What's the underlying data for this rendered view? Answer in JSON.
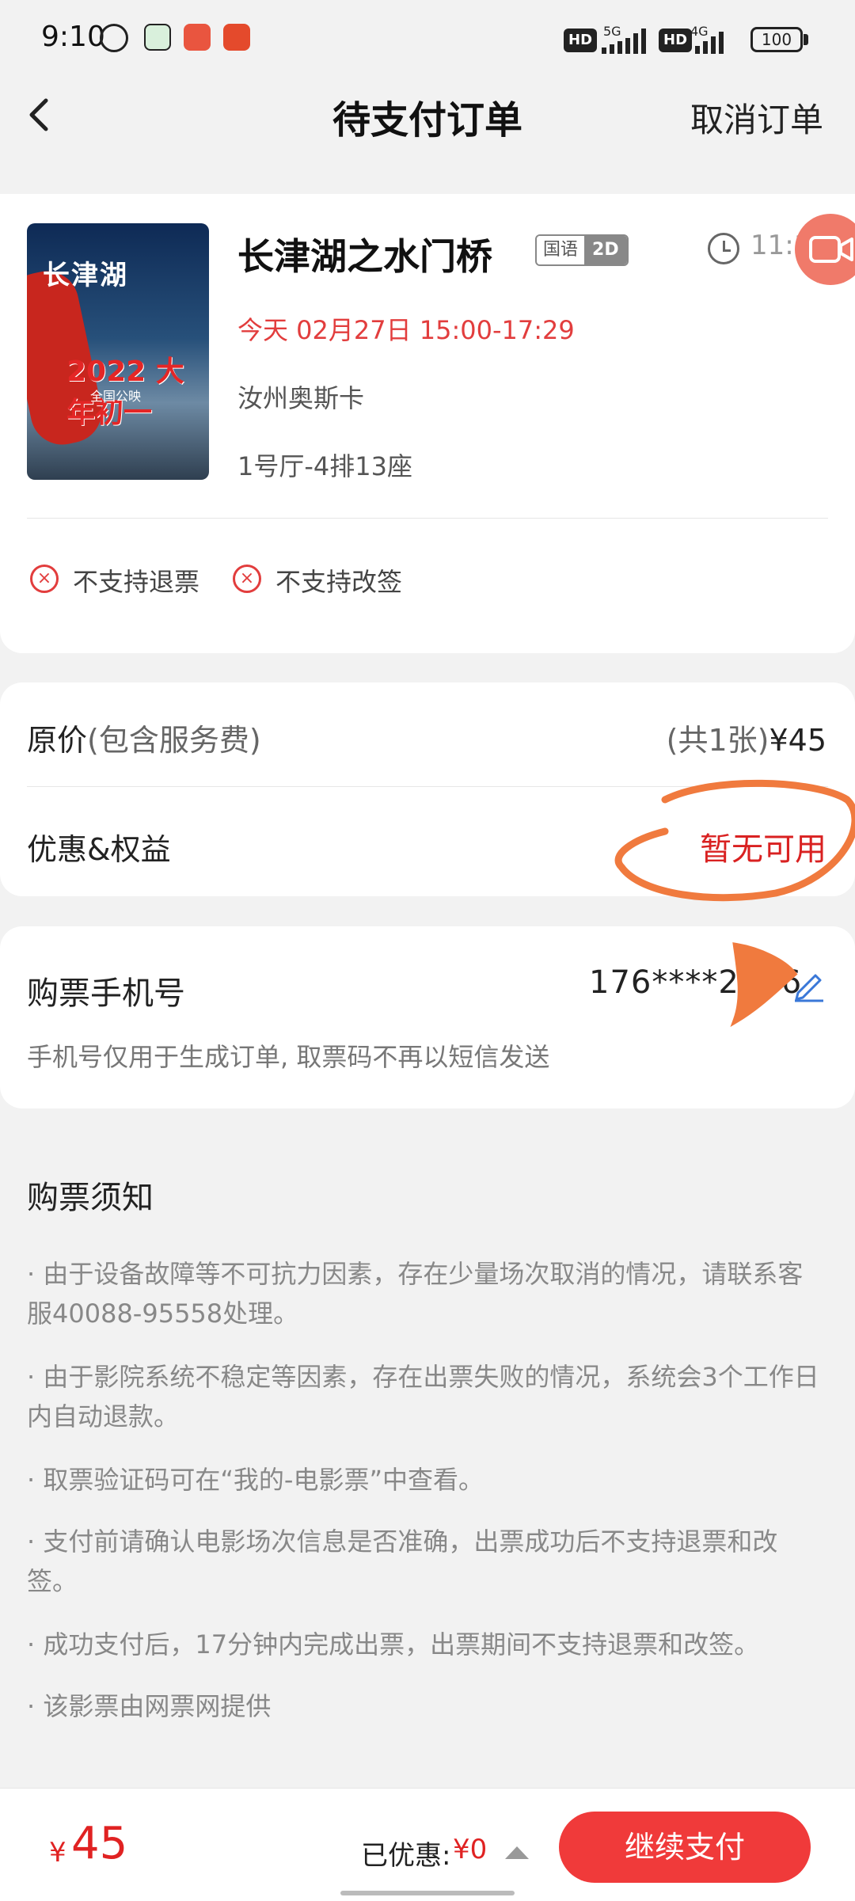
{
  "status_bar": {
    "time": "9:10",
    "hd1": "HD",
    "net1": "5G",
    "hd2": "HD",
    "net2": "4G",
    "battery": "100"
  },
  "header": {
    "title": "待支付订单",
    "cancel_label": "取消订单"
  },
  "movie": {
    "poster_title": "长津湖",
    "poster_year": "2022 大年初一",
    "poster_sub": "全国公映",
    "name": "长津湖之水门桥",
    "language": "国语",
    "format": "2D",
    "countdown": "11:17",
    "show_time": "今天 02月27日 15:00-17:29",
    "cinema": "汝州奥斯卡",
    "seat": "1号厅-4排13座"
  },
  "policies": [
    {
      "label": "不支持退票"
    },
    {
      "label": "不支持改签"
    }
  ],
  "price": {
    "original_label": "原价",
    "original_hint": "(包含服务费)",
    "count": "(共1张)",
    "amount": "¥45",
    "discount_label": "优惠&权益",
    "discount_value": "暂无可用"
  },
  "phone": {
    "label": "购票手机号",
    "number": "176****2036",
    "note": "手机号仅用于生成订单, 取票码不再以短信发送"
  },
  "notice": {
    "title": "购票须知",
    "items": [
      "· 由于设备故障等不可抗力因素，存在少量场次取消的情况，请联系客服40088-95558处理。",
      "· 由于影院系统不稳定等因素，存在出票失败的情况，系统会3个工作日内自动退款。",
      "· 取票验证码可在“我的-电影票”中查看。",
      "· 支付前请确认电影场次信息是否准确，出票成功后不支持退票和改签。",
      "· 成功支付后，17分钟内完成出票，出票期间不支持退票和改签。",
      "· 该影票由网票网提供"
    ]
  },
  "bottom": {
    "currency": "¥",
    "total": "45",
    "discount_label": "已优惠:",
    "discount_value": "¥0",
    "pay_label": "继续支付"
  },
  "colors": {
    "accent_red": "#f03a3a",
    "price_red": "#e02222",
    "annotation_orange": "#f07a3e"
  }
}
